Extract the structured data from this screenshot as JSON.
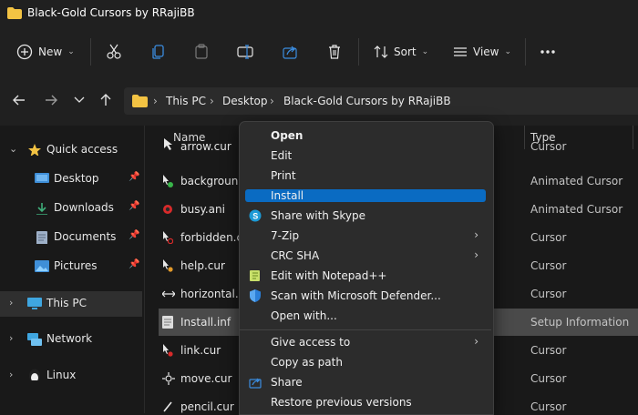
{
  "window": {
    "title": "Black-Gold Cursors by RRajiBB"
  },
  "toolbar": {
    "new_label": "New",
    "sort_label": "Sort",
    "view_label": "View",
    "icons": [
      "cut-icon",
      "copy-icon",
      "paste-icon",
      "rename-icon",
      "share-icon",
      "delete-icon",
      "more-icon"
    ]
  },
  "address": {
    "crumbs": [
      "This PC",
      "Desktop",
      "Black-Gold Cursors by RRajiBB"
    ]
  },
  "nav": {
    "quick_access": "Quick access",
    "desktop": "Desktop",
    "downloads": "Downloads",
    "documents": "Documents",
    "pictures": "Pictures",
    "this_pc": "This PC",
    "network": "Network",
    "linux": "Linux"
  },
  "list": {
    "col_name": "Name",
    "col_type": "Type",
    "files": [
      {
        "name": "arrow.cur",
        "type": "Cursor"
      },
      {
        "name": "background",
        "type": "Animated Cursor"
      },
      {
        "name": "busy.ani",
        "type": "Animated Cursor"
      },
      {
        "name": "forbidden.cu",
        "type": "Cursor"
      },
      {
        "name": "help.cur",
        "type": "Cursor"
      },
      {
        "name": "horizontal.cu",
        "type": "Cursor"
      },
      {
        "name": "Install.inf",
        "type": "Setup Information"
      },
      {
        "name": "link.cur",
        "type": "Cursor"
      },
      {
        "name": "move.cur",
        "type": "Cursor"
      },
      {
        "name": "pencil.cur",
        "type": "Cursor"
      }
    ]
  },
  "menu": {
    "open": "Open",
    "edit": "Edit",
    "print": "Print",
    "install": "Install",
    "share_skype": "Share with Skype",
    "zip": "7-Zip",
    "crc": "CRC SHA",
    "notepad": "Edit with Notepad++",
    "defender": "Scan with Microsoft Defender...",
    "open_with": "Open with...",
    "give_access": "Give access to",
    "copy_path": "Copy as path",
    "share": "Share",
    "restore": "Restore previous versions"
  },
  "colors": {
    "accent": "#0a6bc2",
    "folder": "#f3c343"
  }
}
